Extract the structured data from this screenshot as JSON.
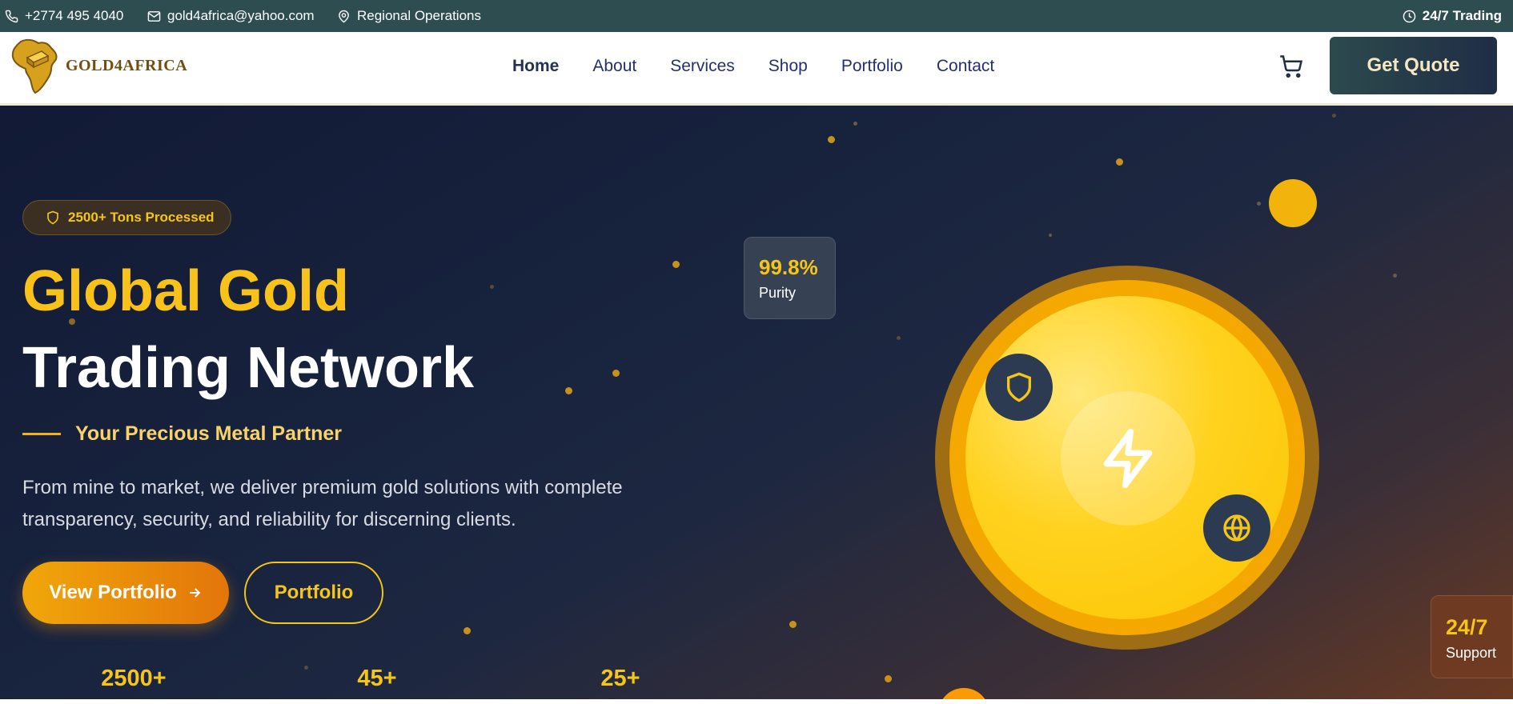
{
  "topbar": {
    "phone": "+2774 495 4040",
    "email": "gold4africa@yahoo.com",
    "location": "Regional Operations",
    "hours": "24/7 Trading"
  },
  "header": {
    "logo_text": "GOLD4AFRICA",
    "nav": [
      "Home",
      "About",
      "Services",
      "Shop",
      "Portfolio",
      "Contact"
    ],
    "active_nav": "Home",
    "quote_label": "Get Quote"
  },
  "hero": {
    "badge": "2500+ Tons Processed",
    "title_line1": "Global Gold",
    "title_line2": "Trading Network",
    "tagline": "Your Precious Metal Partner",
    "description": "From mine to market, we deliver premium gold solutions with complete transparency, security, and reliability for discerning clients.",
    "primary_button": "View Portfolio",
    "secondary_button": "Portfolio",
    "stats": [
      "2500+",
      "45+",
      "25+"
    ],
    "purity": {
      "value": "99.8%",
      "label": "Purity"
    },
    "support": {
      "value": "24/7",
      "label": "Support"
    }
  },
  "colors": {
    "topbar": "#2e4d50",
    "accent_gold": "#f5c518",
    "hero_dark": "#17223d",
    "nav_text": "#24306b"
  },
  "icons": [
    "phone-icon",
    "mail-icon",
    "map-pin-icon",
    "clock-icon",
    "cart-icon",
    "shield-icon",
    "arrow-right-icon",
    "lightning-icon",
    "globe-icon",
    "africa-logo-icon"
  ]
}
